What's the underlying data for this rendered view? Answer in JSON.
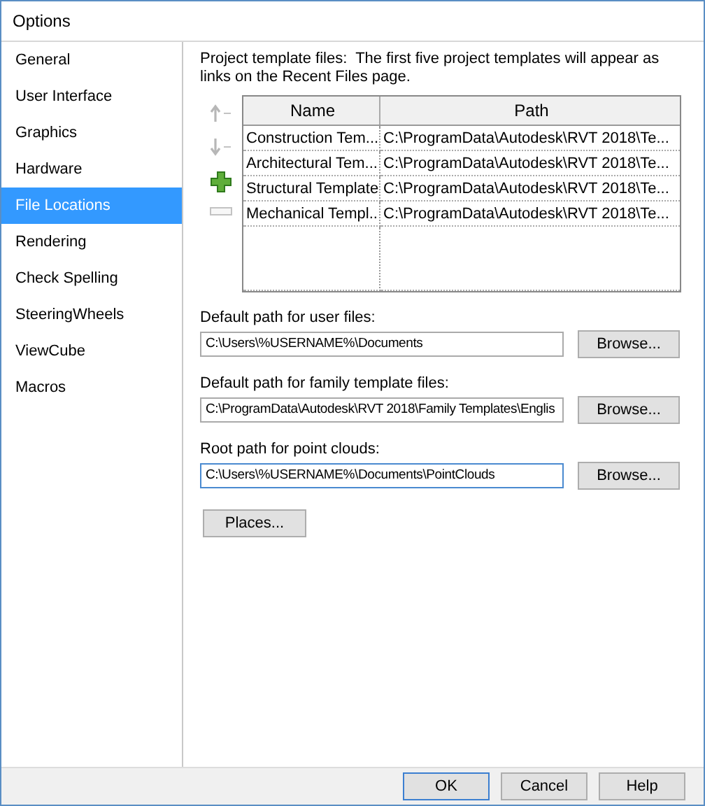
{
  "window": {
    "title": "Options"
  },
  "sidebar": {
    "items": [
      {
        "label": "General",
        "selected": false
      },
      {
        "label": "User Interface",
        "selected": false
      },
      {
        "label": "Graphics",
        "selected": false
      },
      {
        "label": "Hardware",
        "selected": false
      },
      {
        "label": "File Locations",
        "selected": true
      },
      {
        "label": "Rendering",
        "selected": false
      },
      {
        "label": "Check Spelling",
        "selected": false
      },
      {
        "label": "SteeringWheels",
        "selected": false
      },
      {
        "label": "ViewCube",
        "selected": false
      },
      {
        "label": "Macros",
        "selected": false
      }
    ]
  },
  "project_templates": {
    "description": "Project template files:  The first five project templates will appear as links on the Recent Files page.",
    "toolbar": [
      {
        "kind": "up",
        "disabled": true
      },
      {
        "kind": "down",
        "disabled": true
      },
      {
        "kind": "add",
        "disabled": false
      },
      {
        "kind": "remove",
        "disabled": true
      }
    ],
    "table": {
      "columns": [
        "Name",
        "Path"
      ],
      "rows": [
        [
          "Construction Tem...",
          "C:\\ProgramData\\Autodesk\\RVT 2018\\Te..."
        ],
        [
          "Architectural Tem...",
          "C:\\ProgramData\\Autodesk\\RVT 2018\\Te..."
        ],
        [
          "Structural Template",
          "C:\\ProgramData\\Autodesk\\RVT 2018\\Te..."
        ],
        [
          "Mechanical Templ...",
          "C:\\ProgramData\\Autodesk\\RVT 2018\\Te..."
        ]
      ]
    }
  },
  "paths": [
    {
      "label": "Default path for user files:",
      "value": "C:\\Users\\%USERNAME%\\Documents",
      "focused": false,
      "button": "Browse..."
    },
    {
      "label": "Default path for family template files:",
      "value": "C:\\ProgramData\\Autodesk\\RVT 2018\\Family Templates\\Englis",
      "focused": false,
      "button": "Browse..."
    },
    {
      "label": "Root path for point clouds:",
      "value": "C:\\Users\\%USERNAME%\\Documents\\PointClouds",
      "focused": true,
      "button": "Browse..."
    }
  ],
  "places_button": "Places...",
  "buttons": [
    {
      "label": "OK",
      "default": true
    },
    {
      "label": "Cancel",
      "default": false
    },
    {
      "label": "Help",
      "default": false
    }
  ]
}
